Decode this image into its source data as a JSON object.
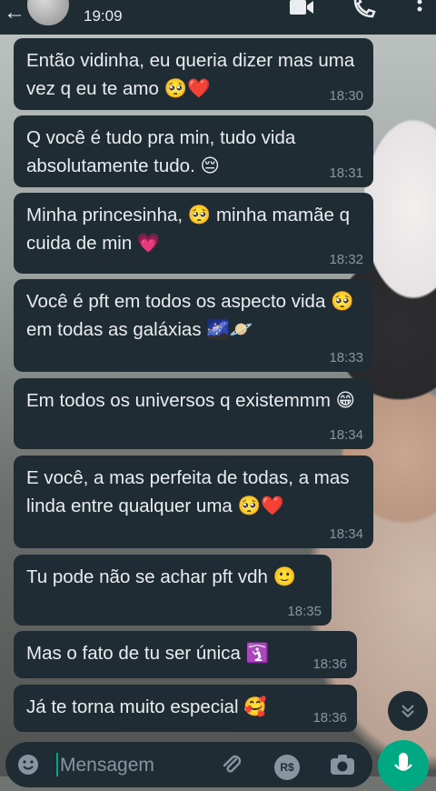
{
  "header": {
    "back_icon": "back-arrow-icon",
    "time": "19:09",
    "icons": [
      "video-call-icon",
      "voice-call-icon",
      "more-options-icon"
    ]
  },
  "messages": [
    {
      "text": "Então vidinha, eu queria dizer mas uma vez q eu te amo 🥺❤️",
      "time": "18:30"
    },
    {
      "text": "Q você é tudo pra min, tudo vida absolutamente tudo. 😔",
      "time": "18:31"
    },
    {
      "text": "Minha princesinha, 🥺 minha mamãe q cuida de min 💗",
      "time": "18:32"
    },
    {
      "text": "Você é pft em todos os aspecto vida 🥺 em todas as galáxias 🌌🪐",
      "time": "18:33"
    },
    {
      "text": "Em todos os universos q existemmm 😁",
      "time": "18:34"
    },
    {
      "text": "E você, a mas perfeita de todas, a mas linda entre qualquer uma 🥺❤️",
      "time": "18:34"
    },
    {
      "text": "Tu pode não se achar pft vdh 🙂",
      "time": "18:35"
    },
    {
      "text": "Mas o fato de tu ser única 🛐",
      "time": "18:36"
    },
    {
      "text": "Já te torna muito especial 🥰",
      "time": "18:36"
    }
  ],
  "composer": {
    "placeholder": "Mensagem",
    "pay_label": "R$"
  },
  "colors": {
    "bubble_bg": "#202c33",
    "header_bg": "#1f2c34",
    "accent": "#00a884",
    "timestamp": "#8696a0"
  }
}
